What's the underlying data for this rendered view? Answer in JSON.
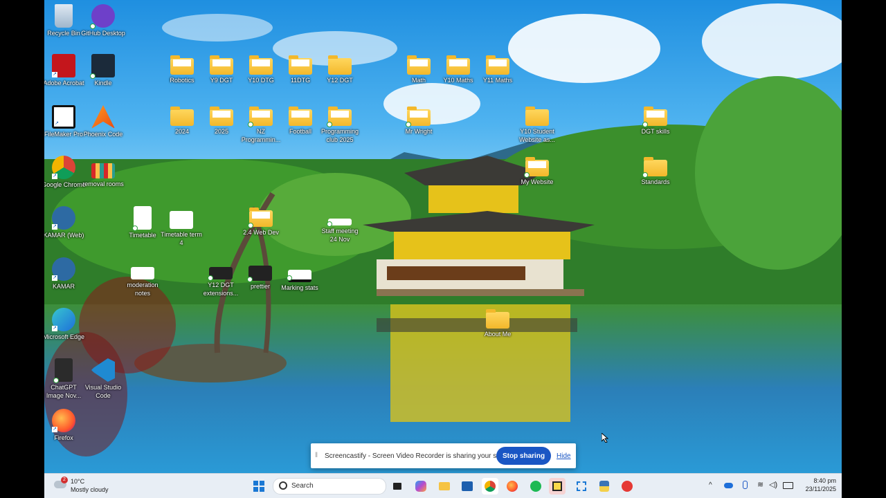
{
  "desktop": {
    "icons": [
      {
        "label": "Recycle Bin",
        "kind": "recycle-bin-icon"
      },
      {
        "label": "GitHub Desktop",
        "kind": "github-icon"
      },
      {
        "label": "Adobe Acrobat",
        "kind": "acrobat-icon"
      },
      {
        "label": "Kindle",
        "kind": "kindle-icon"
      },
      {
        "label": "FileMaker Pro",
        "kind": "filemaker-icon"
      },
      {
        "label": "Phoenix Code",
        "kind": "phoenix-code-icon"
      },
      {
        "label": "Google Chrome",
        "kind": "chrome-icon"
      },
      {
        "label": "removal rooms",
        "kind": "spreadsheet-icon"
      },
      {
        "label": "KAMAR (Web)",
        "kind": "kamar-icon"
      },
      {
        "label": "Timetable",
        "kind": "document-icon"
      },
      {
        "label": "Timetable term 4",
        "kind": "document-icon"
      },
      {
        "label": "KAMAR",
        "kind": "kamar-icon"
      },
      {
        "label": "moderation notes",
        "kind": "document-icon"
      },
      {
        "label": "Y12 DGT extensions...",
        "kind": "document-icon"
      },
      {
        "label": "prettier",
        "kind": "document-icon"
      },
      {
        "label": "Marking stats",
        "kind": "document-icon"
      },
      {
        "label": "Microsoft Edge",
        "kind": "edge-icon"
      },
      {
        "label": "ChatGPT Image Nov...",
        "kind": "image-icon"
      },
      {
        "label": "Visual Studio Code",
        "kind": "vscode-icon"
      },
      {
        "label": "Firefox",
        "kind": "firefox-icon"
      },
      {
        "label": "Robotics",
        "kind": "folder-icon"
      },
      {
        "label": "Y9 DGT",
        "kind": "folder-icon"
      },
      {
        "label": "Y10 DTG",
        "kind": "folder-icon"
      },
      {
        "label": "11DTG",
        "kind": "folder-icon"
      },
      {
        "label": "Y12 DGT",
        "kind": "folder-icon"
      },
      {
        "label": "Math",
        "kind": "folder-icon"
      },
      {
        "label": "Y10 Maths",
        "kind": "folder-icon"
      },
      {
        "label": "Y11 Maths",
        "kind": "folder-icon"
      },
      {
        "label": "2024",
        "kind": "folder-icon"
      },
      {
        "label": "2025",
        "kind": "folder-icon"
      },
      {
        "label": "NZ Programmin...",
        "kind": "folder-icon"
      },
      {
        "label": "Football",
        "kind": "folder-icon"
      },
      {
        "label": "Programming club 2025",
        "kind": "folder-icon"
      },
      {
        "label": "Mr Wright",
        "kind": "folder-icon"
      },
      {
        "label": "Y10 Student Website as...",
        "kind": "folder-icon"
      },
      {
        "label": "DGT skills",
        "kind": "folder-icon"
      },
      {
        "label": "My Website",
        "kind": "folder-icon"
      },
      {
        "label": "Standards",
        "kind": "folder-icon"
      },
      {
        "label": "2.4 Web Dev",
        "kind": "folder-icon"
      },
      {
        "label": "Staff meeting 24 Nov",
        "kind": "document-icon"
      },
      {
        "label": "About Me",
        "kind": "folder-icon"
      }
    ]
  },
  "share_bar": {
    "message": "Screencastify - Screen Video Recorder is sharing your screen.",
    "stop_label": "Stop sharing",
    "hide_label": "Hide"
  },
  "taskbar": {
    "weather_temp": "10°C",
    "weather_desc": "Mostly cloudy",
    "weather_badge": "2",
    "search_placeholder": "Search",
    "time": "8:40 pm",
    "date": "23/11/2025",
    "apps": [
      "start-icon",
      "search-icon",
      "task-view-icon",
      "copilot-icon",
      "file-explorer-icon",
      "store-icon",
      "chrome-icon",
      "firefox-icon",
      "spotify-icon",
      "sticky-notes-icon",
      "snipping-tool-icon",
      "python-icon",
      "acrobat-icon"
    ]
  },
  "colors": {
    "accent": "#1a56c4",
    "folder": "#f3b82b",
    "taskbar": "#e8eef5"
  }
}
